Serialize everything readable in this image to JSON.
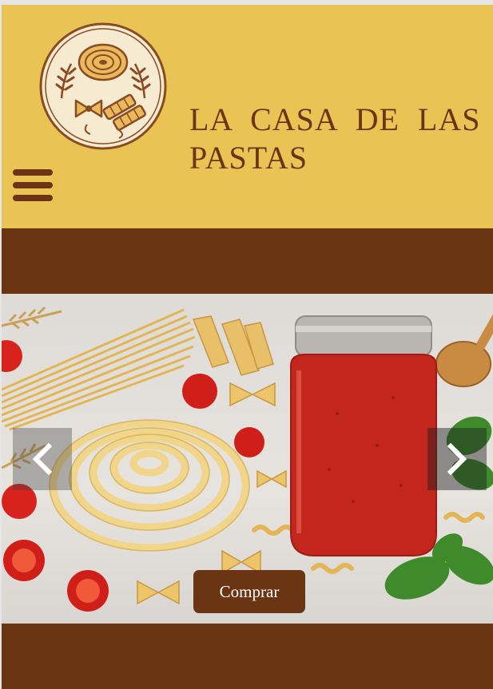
{
  "brand": {
    "title_line1": "LA CASA DE LAS",
    "title_line2": "PASTAS",
    "logo_icon": "pasta-logo-icon",
    "colors": {
      "header_bg": "#e9c454",
      "brand_brown": "#6b3413"
    }
  },
  "nav": {
    "menu_icon": "hamburger-menu-icon"
  },
  "carousel": {
    "prev_icon": "chevron-left-icon",
    "next_icon": "chevron-right-icon",
    "cta_label": "Comprar"
  }
}
